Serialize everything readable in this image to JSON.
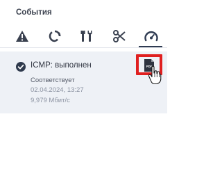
{
  "panel": {
    "title": "События"
  },
  "tabs": [
    {
      "id": "alerts",
      "icon": "warning-triangle-icon"
    },
    {
      "id": "refresh",
      "icon": "circle-arrows-icon"
    },
    {
      "id": "tools",
      "icon": "tools-icon"
    },
    {
      "id": "cut",
      "icon": "scissors-icon"
    },
    {
      "id": "speed",
      "icon": "speedometer-icon",
      "active": true
    }
  ],
  "event": {
    "status_icon": "check-circle-icon",
    "title": "ICMP: выполнен",
    "status": "Соответствует",
    "datetime": "02.04.2024, 13:27",
    "speed": "9,979 Мбит/с",
    "action_icon": "pdf-file-icon"
  },
  "colors": {
    "accent": "#2f3b52",
    "highlight": "#e02020",
    "row_bg": "#eef1f6"
  }
}
